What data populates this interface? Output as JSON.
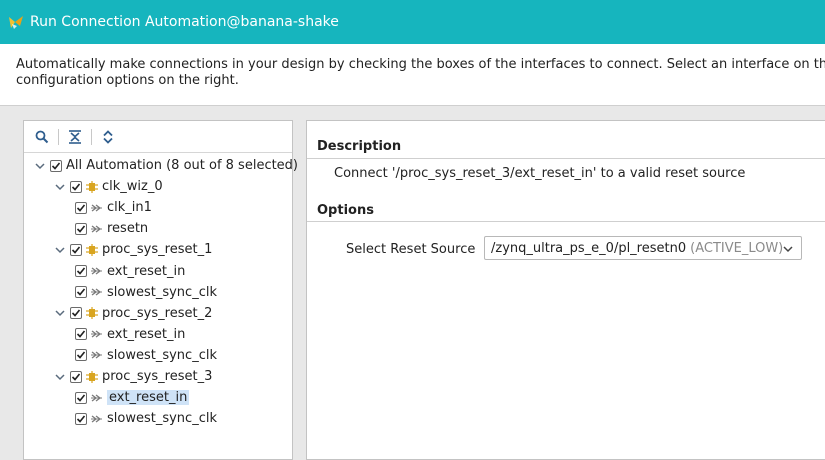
{
  "window": {
    "title": "Run Connection Automation@banana-shake"
  },
  "description_bar": {
    "line1": "Automatically make connections in your design by checking the boxes of the interfaces to connect. Select an interface on the lef",
    "line2": "configuration options on the right."
  },
  "toolbar": {
    "icons": [
      "search-icon",
      "collapse-all-icon",
      "expand-all-icon"
    ]
  },
  "tree": [
    {
      "label": "All Automation (8 out of 8 selected)",
      "level": 0,
      "expanded": true,
      "checked": true,
      "icon": "none"
    },
    {
      "label": "clk_wiz_0",
      "level": 1,
      "expanded": true,
      "checked": true,
      "icon": "block"
    },
    {
      "label": "clk_in1",
      "level": 2,
      "checked": true,
      "icon": "pin"
    },
    {
      "label": "resetn",
      "level": 2,
      "checked": true,
      "icon": "pin"
    },
    {
      "label": "proc_sys_reset_1",
      "level": 1,
      "expanded": true,
      "checked": true,
      "icon": "block"
    },
    {
      "label": "ext_reset_in",
      "level": 2,
      "checked": true,
      "icon": "pin"
    },
    {
      "label": "slowest_sync_clk",
      "level": 2,
      "checked": true,
      "icon": "pin"
    },
    {
      "label": "proc_sys_reset_2",
      "level": 1,
      "expanded": true,
      "checked": true,
      "icon": "block"
    },
    {
      "label": "ext_reset_in",
      "level": 2,
      "checked": true,
      "icon": "pin"
    },
    {
      "label": "slowest_sync_clk",
      "level": 2,
      "checked": true,
      "icon": "pin"
    },
    {
      "label": "proc_sys_reset_3",
      "level": 1,
      "expanded": true,
      "checked": true,
      "icon": "block"
    },
    {
      "label": "ext_reset_in",
      "level": 2,
      "checked": true,
      "icon": "pin",
      "selected": true
    },
    {
      "label": "slowest_sync_clk",
      "level": 2,
      "checked": true,
      "icon": "pin"
    }
  ],
  "details": {
    "description_title": "Description",
    "description_text": "Connect '/proc_sys_reset_3/ext_reset_in' to a valid reset source",
    "options_title": "Options",
    "reset_source_label": "Select Reset Source",
    "reset_source_value": "/zynq_ultra_ps_e_0/pl_resetn0",
    "reset_source_suffix": "(ACTIVE_LOW)"
  },
  "colors": {
    "titlebar": "#16b5be",
    "selection": "#cfe3f7",
    "block_icon": "#d9a520",
    "chevron": "#5a6b7d"
  }
}
